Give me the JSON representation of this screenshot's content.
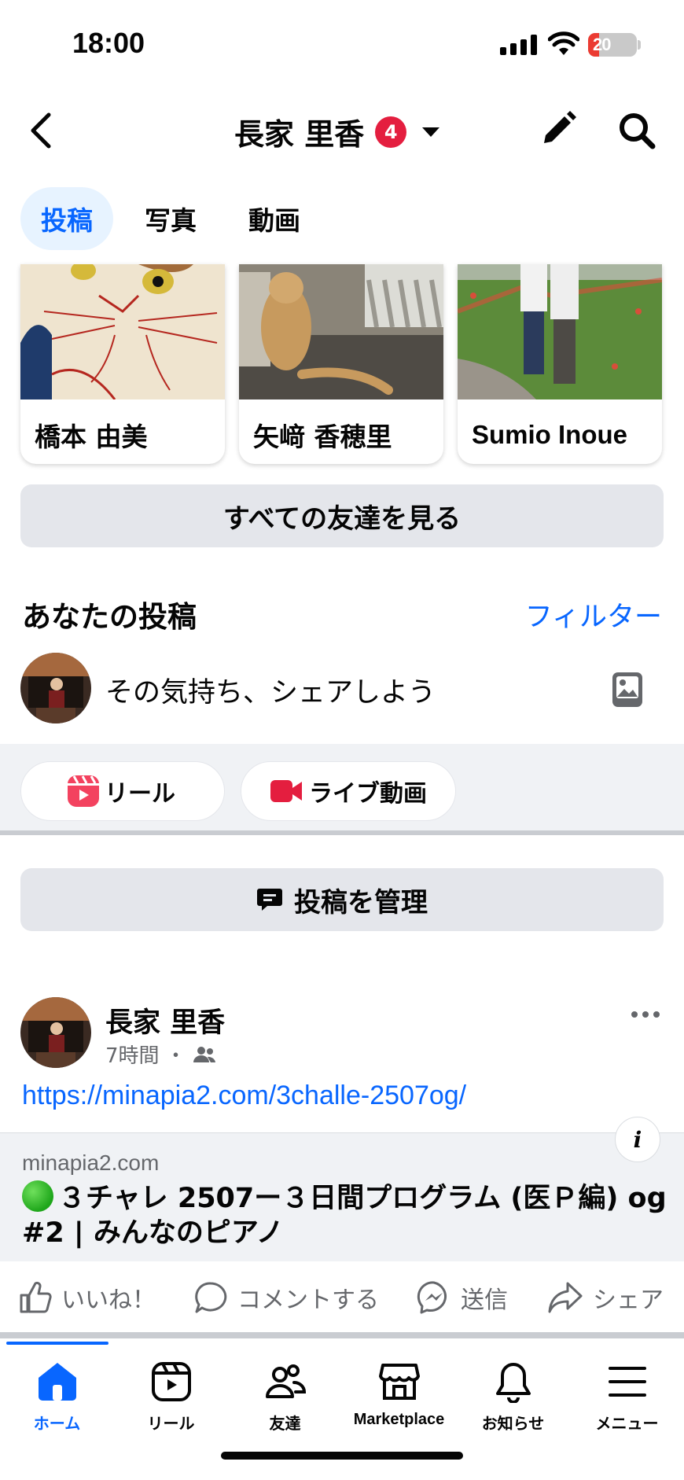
{
  "status_bar": {
    "time": "18:00",
    "battery": "20"
  },
  "header": {
    "title": "長家 里香",
    "badge_count": "4"
  },
  "tabs": [
    {
      "label": "投稿",
      "active": true
    },
    {
      "label": "写真",
      "active": false
    },
    {
      "label": "動画",
      "active": false
    }
  ],
  "friends": [
    {
      "name": "橋本 由美"
    },
    {
      "name": "矢﨑 香穂里"
    },
    {
      "name": "Sumio Inoue"
    }
  ],
  "see_all_friends": "すべての友達を見る",
  "your_posts": {
    "title": "あなたの投稿",
    "filter": "フィルター"
  },
  "composer": {
    "placeholder": "その気持ち、シェアしよう"
  },
  "chips": {
    "reels": "リール",
    "live": "ライブ動画"
  },
  "manage_posts": "投稿を管理",
  "post": {
    "author": "長家 里香",
    "time": "7時間",
    "separator": "・",
    "link": "https://minapia2.com/3challe-2507og/",
    "card": {
      "domain": "minapia2.com",
      "headline": "３チャレ 2507ー３日間プログラム (医Ｐ編) og #2 | みんなのピアノ"
    },
    "actions": {
      "like": "いいね！",
      "comment": "コメントする",
      "send": "送信",
      "share": "シェア"
    }
  },
  "bottom_nav": [
    {
      "label": "ホーム",
      "icon": "home-icon",
      "active": true
    },
    {
      "label": "リール",
      "icon": "reels-icon",
      "active": false
    },
    {
      "label": "友達",
      "icon": "friends-icon",
      "active": false
    },
    {
      "label": "Marketplace",
      "icon": "marketplace-icon",
      "active": false
    },
    {
      "label": "お知らせ",
      "icon": "bell-icon",
      "active": false
    },
    {
      "label": "メニュー",
      "icon": "menu-icon",
      "active": false
    }
  ],
  "colors": {
    "accent": "#0866ff",
    "badge": "#e41e3f",
    "reels": "#f3425f",
    "live": "#e41e3f"
  }
}
